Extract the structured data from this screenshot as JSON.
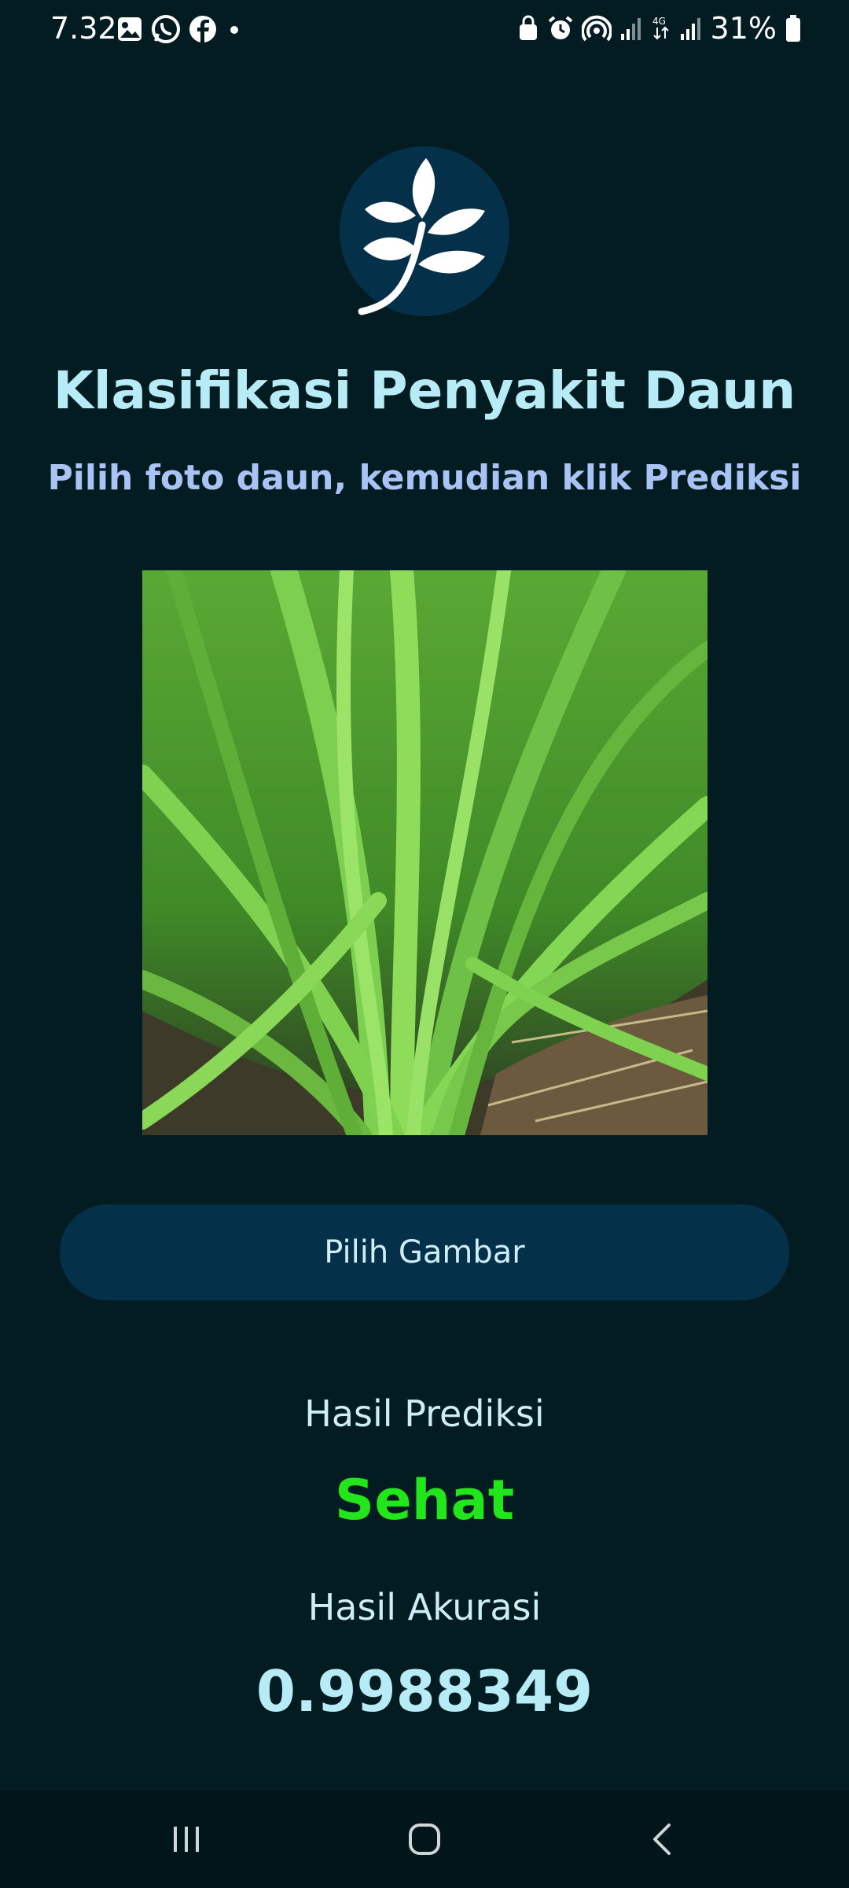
{
  "status_bar": {
    "time": "7.32",
    "battery": "31%",
    "network": "4G"
  },
  "app": {
    "title": "Klasifikasi Penyakit Daun",
    "subtitle": "Pilih foto daun, kemudian klik Prediksi",
    "pick_button_label": "Pilih Gambar",
    "prediction_label": "Hasil Prediksi",
    "prediction_value": "Sehat",
    "accuracy_label": "Hasil Akurasi",
    "accuracy_value": "0.9988349"
  },
  "icons": {
    "logo": "leaf-branch-icon",
    "nav_recent": "recent-apps-icon",
    "nav_home": "home-icon",
    "nav_back": "back-icon"
  },
  "colors": {
    "background": "#031c22",
    "accent": "#05304a",
    "prediction": "#22e51b",
    "title": "#b7ecf6"
  }
}
